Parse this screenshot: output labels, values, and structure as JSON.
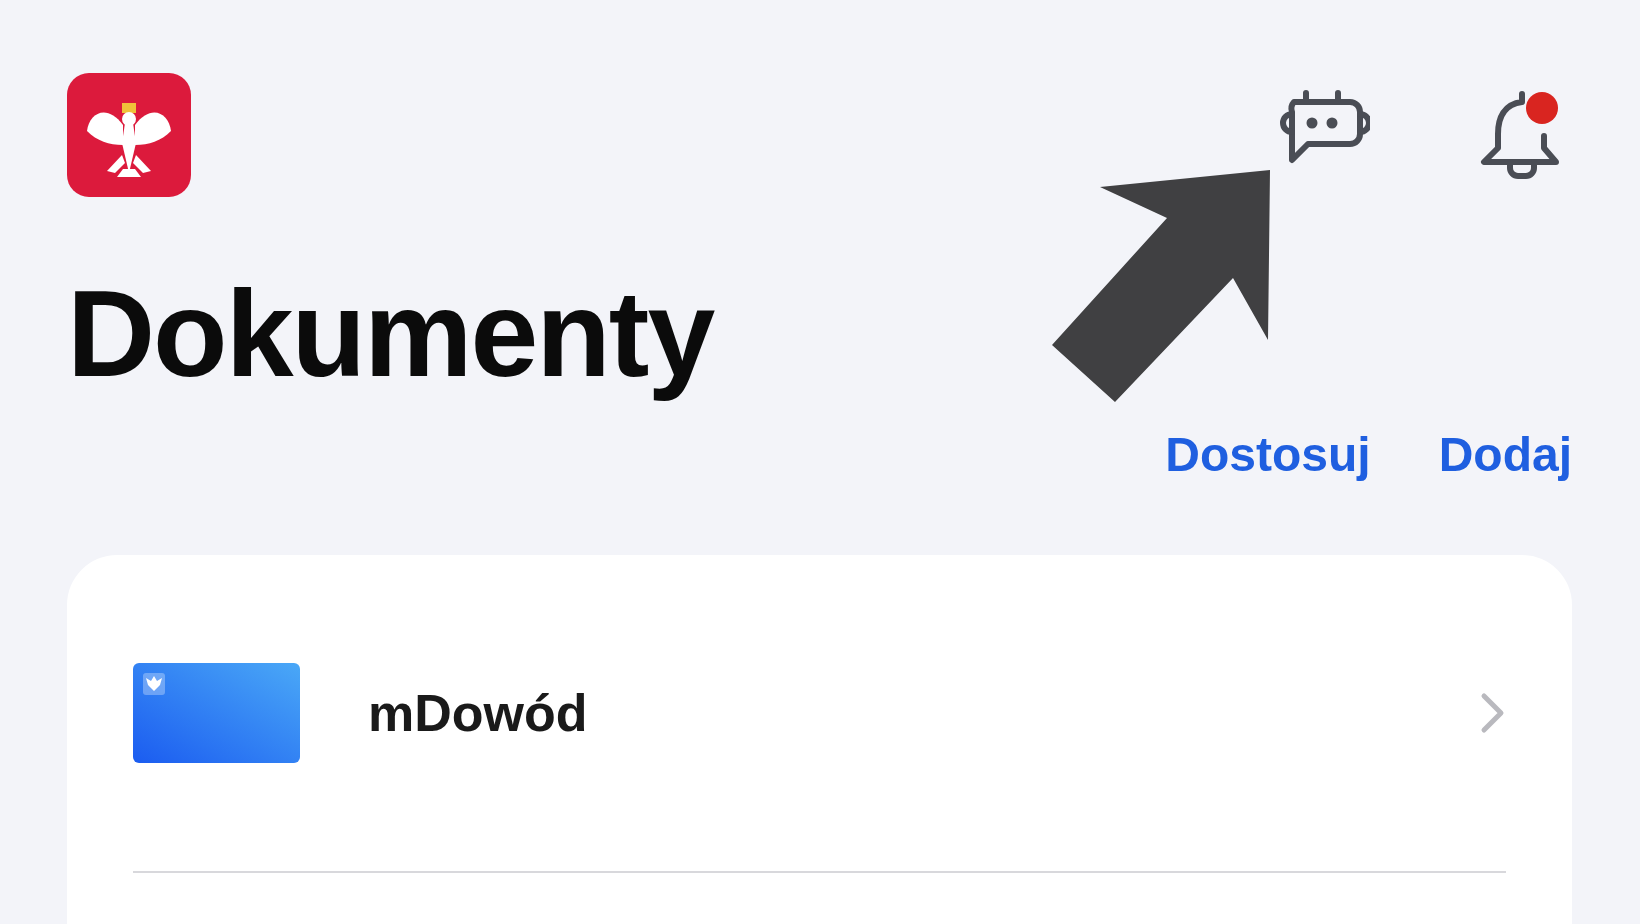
{
  "header": {
    "title": "Dokumenty",
    "notifications": {
      "unread": true
    }
  },
  "actions": [
    {
      "label": "Dostosuj"
    },
    {
      "label": "Dodaj"
    }
  ],
  "documents": [
    {
      "name": "mDowód"
    }
  ]
}
